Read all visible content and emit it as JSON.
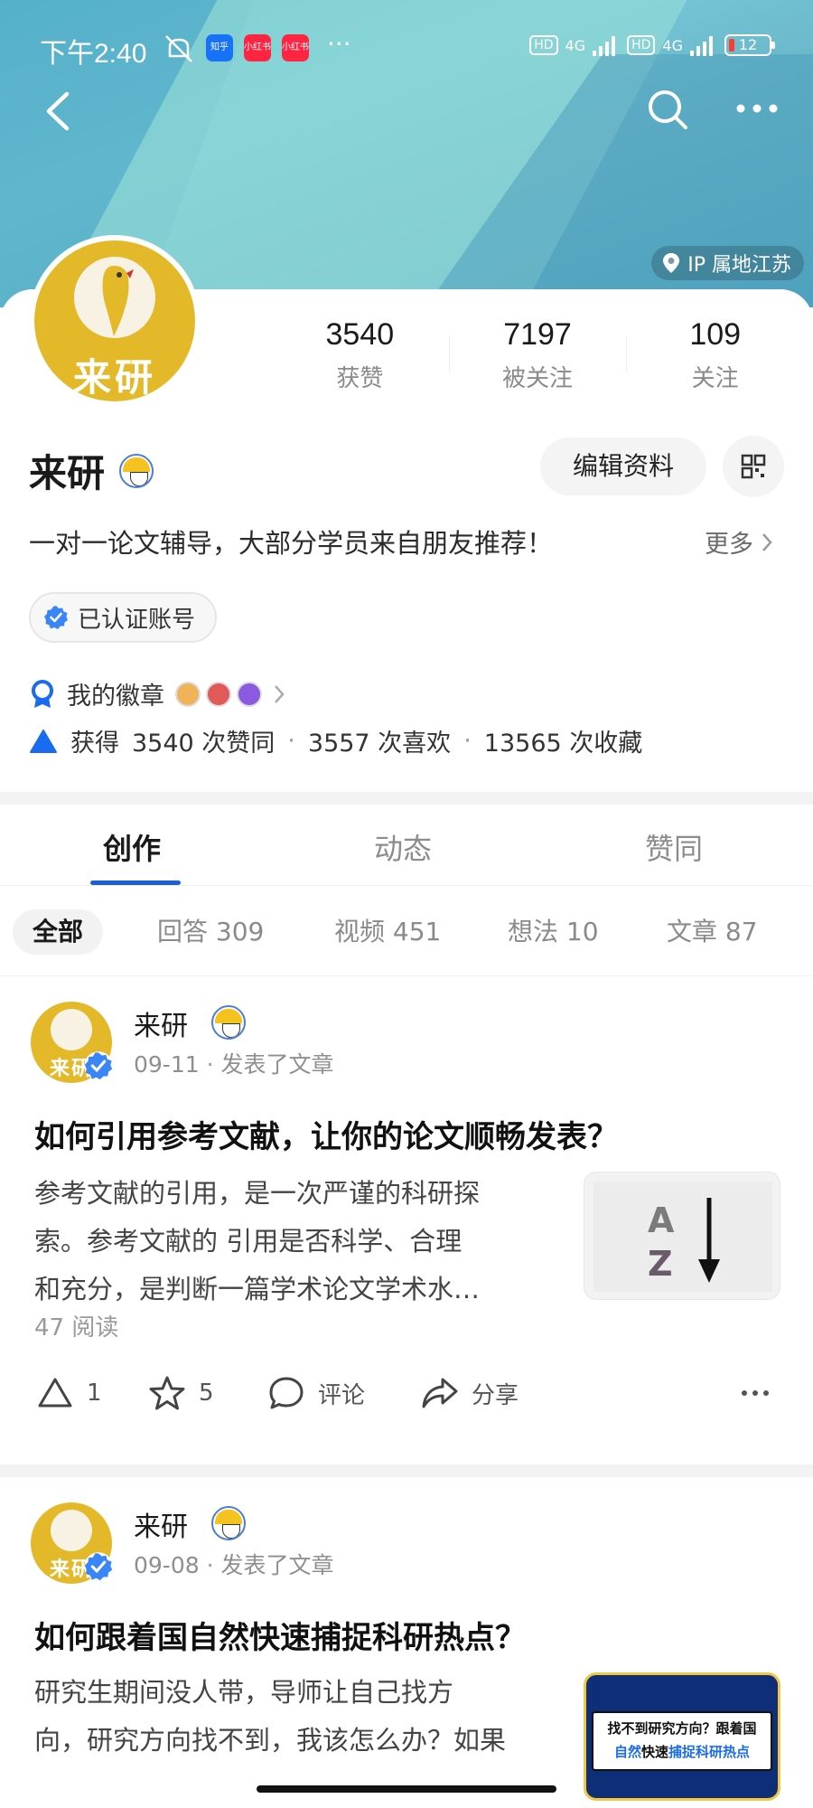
{
  "status_bar": {
    "time": "下午2:40",
    "apps": [
      "知乎",
      "小红书",
      "小红书"
    ],
    "more": "···",
    "network1": "HD",
    "signal1": "4G",
    "network2": "HD",
    "signal2": "4G",
    "battery": "12"
  },
  "header": {
    "back_icon": "chevron-left-icon",
    "search_icon": "search-icon",
    "more_icon": "more-horizontal-icon",
    "ip_location": "IP 属地江苏"
  },
  "profile": {
    "avatar_text": "来研",
    "name": "来研",
    "stats": [
      {
        "value": "3540",
        "label": "获赞"
      },
      {
        "value": "7197",
        "label": "被关注"
      },
      {
        "value": "109",
        "label": "关注"
      }
    ],
    "edit_label": "编辑资料",
    "bio": "一对一论文辅导，大部分学员来自朋友推荐！",
    "more_label": "更多",
    "verified_label": "已认证账号",
    "badges_label": "我的徽章",
    "summary": {
      "prefix": "获得",
      "likes": "3540 次赞同",
      "favs": "3557 次喜欢",
      "collects": "13565 次收藏"
    }
  },
  "tabs": [
    "创作",
    "动态",
    "赞同"
  ],
  "active_tab": "创作",
  "subtabs": [
    "全部",
    "回答 309",
    "视频 451",
    "想法 10",
    "文章 87"
  ],
  "posts": [
    {
      "author": "来研",
      "avatar_text": "来研",
      "date": "09-11",
      "action": "发表了文章",
      "title": "如何引用参考文献，让你的论文顺畅发表？",
      "excerpt_lines": [
        "参考文献的引用，是一次严谨的科研探",
        "索。参考文献的 引用是否科学、合理",
        "和充分，是判断一篇学术论文学术水…"
      ],
      "reads": "47 阅读",
      "upvotes": "1",
      "stars": "5",
      "comment_label": "评论",
      "share_label": "分享"
    },
    {
      "author": "来研",
      "avatar_text": "来研",
      "date": "09-08",
      "action": "发表了文章",
      "title": "如何跟着国自然快速捕捉科研热点？",
      "excerpt_lines": [
        "研究生期间没人带，导师让自己找方",
        "向，研究方向找不到，我该怎么办？如果"
      ],
      "thumb_line1": "找不到研究方向？跟着国",
      "thumb_line2a": "自然",
      "thumb_line2b": "快速",
      "thumb_line2c": "捕捉科研热点"
    }
  ],
  "colors": {
    "accent": "#1a5fd8",
    "avatar_yellow": "#e3b92a",
    "verified_blue": "#3b86f6"
  }
}
